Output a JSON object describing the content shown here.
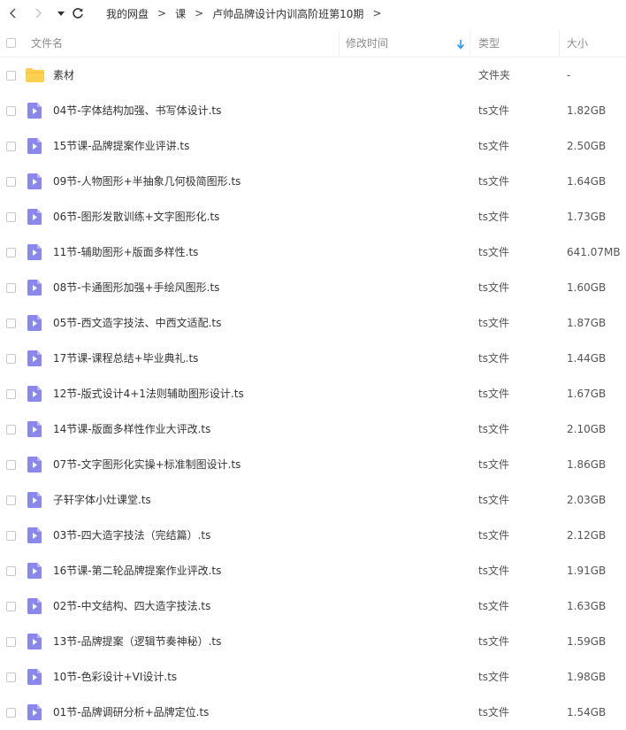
{
  "nav": {
    "back_icon": "chevron-left-icon",
    "forward_icon": "chevron-right-icon",
    "dropdown_icon": "caret-down-icon",
    "refresh_icon": "refresh-icon",
    "breadcrumb": [
      "我的网盘",
      "课",
      "卢帅品牌设计内训高阶班第10期"
    ],
    "separator": ">"
  },
  "header": {
    "name": "文件名",
    "modified": "修改时间",
    "type": "类型",
    "size": "大小",
    "sort_icon": "sort-down-arrow-icon"
  },
  "colors": {
    "accent": "#1890ff",
    "folder": "#ffd04f",
    "video_icon": "#8a88ef"
  },
  "files": [
    {
      "name": "素材",
      "type": "文件夹",
      "size": "-",
      "kind": "folder"
    },
    {
      "name": "04节-字体结构加强、书写体设计.ts",
      "type": "ts文件",
      "size": "1.82GB",
      "kind": "video"
    },
    {
      "name": "15节课-品牌提案作业评讲.ts",
      "type": "ts文件",
      "size": "2.50GB",
      "kind": "video"
    },
    {
      "name": "09节-人物图形+半抽象几何极简图形.ts",
      "type": "ts文件",
      "size": "1.64GB",
      "kind": "video"
    },
    {
      "name": "06节-图形发散训练+文字图形化.ts",
      "type": "ts文件",
      "size": "1.73GB",
      "kind": "video"
    },
    {
      "name": "11节-辅助图形+版面多样性.ts",
      "type": "ts文件",
      "size": "641.07MB",
      "kind": "video"
    },
    {
      "name": "08节-卡通图形加强+手绘风图形.ts",
      "type": "ts文件",
      "size": "1.60GB",
      "kind": "video"
    },
    {
      "name": "05节-西文造字技法、中西文适配.ts",
      "type": "ts文件",
      "size": "1.87GB",
      "kind": "video"
    },
    {
      "name": "17节课-课程总结+毕业典礼.ts",
      "type": "ts文件",
      "size": "1.44GB",
      "kind": "video"
    },
    {
      "name": "12节-版式设计4+1法则辅助图形设计.ts",
      "type": "ts文件",
      "size": "1.67GB",
      "kind": "video"
    },
    {
      "name": "14节课-版面多样性作业大评改.ts",
      "type": "ts文件",
      "size": "2.10GB",
      "kind": "video"
    },
    {
      "name": "07节-文字图形化实操+标准制图设计.ts",
      "type": "ts文件",
      "size": "1.86GB",
      "kind": "video"
    },
    {
      "name": "子轩字体小灶课堂.ts",
      "type": "ts文件",
      "size": "2.03GB",
      "kind": "video"
    },
    {
      "name": "03节-四大造字技法（完结篇）.ts",
      "type": "ts文件",
      "size": "2.12GB",
      "kind": "video"
    },
    {
      "name": "16节课-第二轮品牌提案作业评改.ts",
      "type": "ts文件",
      "size": "1.91GB",
      "kind": "video"
    },
    {
      "name": "02节-中文结构、四大造字技法.ts",
      "type": "ts文件",
      "size": "1.63GB",
      "kind": "video"
    },
    {
      "name": "13节-品牌提案（逻辑节奏神秘）.ts",
      "type": "ts文件",
      "size": "1.59GB",
      "kind": "video"
    },
    {
      "name": "10节-色彩设计+VI设计.ts",
      "type": "ts文件",
      "size": "1.98GB",
      "kind": "video"
    },
    {
      "name": "01节-品牌调研分析+品牌定位.ts",
      "type": "ts文件",
      "size": "1.54GB",
      "kind": "video"
    }
  ]
}
